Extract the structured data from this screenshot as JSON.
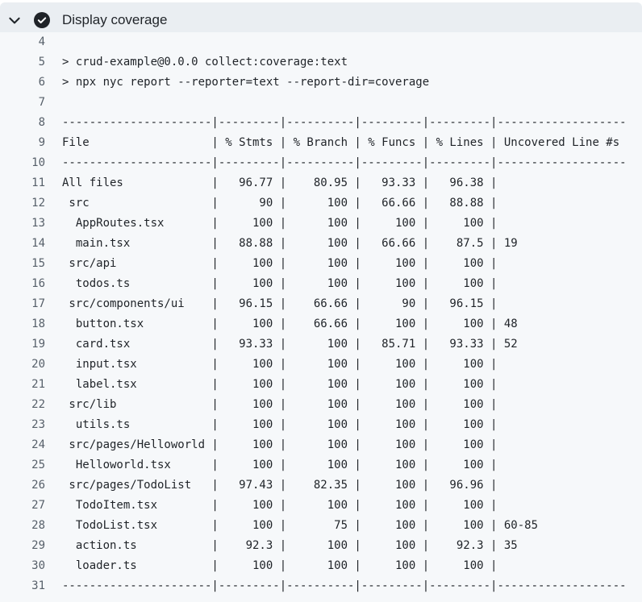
{
  "step": {
    "title": "Display coverage",
    "status": "success"
  },
  "log": [
    {
      "n": "4",
      "t": ""
    },
    {
      "n": "5",
      "t": "> crud-example@0.0.0 collect:coverage:text"
    },
    {
      "n": "6",
      "t": "> npx nyc report --reporter=text --report-dir=coverage"
    },
    {
      "n": "7",
      "t": ""
    },
    {
      "n": "8",
      "t": "----------------------|---------|----------|---------|---------|-------------------"
    },
    {
      "n": "9",
      "t": "File                  | % Stmts | % Branch | % Funcs | % Lines | Uncovered Line #s"
    },
    {
      "n": "10",
      "t": "----------------------|---------|----------|---------|---------|-------------------"
    },
    {
      "n": "11",
      "t": "All files             |   96.77 |    80.95 |   93.33 |   96.38 |"
    },
    {
      "n": "12",
      "t": " src                  |      90 |      100 |   66.66 |   88.88 |"
    },
    {
      "n": "13",
      "t": "  AppRoutes.tsx       |     100 |      100 |     100 |     100 |"
    },
    {
      "n": "14",
      "t": "  main.tsx            |   88.88 |      100 |   66.66 |    87.5 | 19"
    },
    {
      "n": "15",
      "t": " src/api              |     100 |      100 |     100 |     100 |"
    },
    {
      "n": "16",
      "t": "  todos.ts            |     100 |      100 |     100 |     100 |"
    },
    {
      "n": "17",
      "t": " src/components/ui    |   96.15 |    66.66 |      90 |   96.15 |"
    },
    {
      "n": "18",
      "t": "  button.tsx          |     100 |    66.66 |     100 |     100 | 48"
    },
    {
      "n": "19",
      "t": "  card.tsx            |   93.33 |      100 |   85.71 |   93.33 | 52"
    },
    {
      "n": "20",
      "t": "  input.tsx           |     100 |      100 |     100 |     100 |"
    },
    {
      "n": "21",
      "t": "  label.tsx           |     100 |      100 |     100 |     100 |"
    },
    {
      "n": "22",
      "t": " src/lib              |     100 |      100 |     100 |     100 |"
    },
    {
      "n": "23",
      "t": "  utils.ts            |     100 |      100 |     100 |     100 |"
    },
    {
      "n": "24",
      "t": " src/pages/Helloworld |     100 |      100 |     100 |     100 |"
    },
    {
      "n": "25",
      "t": "  Helloworld.tsx      |     100 |      100 |     100 |     100 |"
    },
    {
      "n": "26",
      "t": " src/pages/TodoList   |   97.43 |    82.35 |     100 |   96.96 |"
    },
    {
      "n": "27",
      "t": "  TodoItem.tsx        |     100 |      100 |     100 |     100 |"
    },
    {
      "n": "28",
      "t": "  TodoList.tsx        |     100 |       75 |     100 |     100 | 60-85"
    },
    {
      "n": "29",
      "t": "  action.ts           |    92.3 |      100 |     100 |    92.3 | 35"
    },
    {
      "n": "30",
      "t": "  loader.ts           |     100 |      100 |     100 |     100 |"
    },
    {
      "n": "31",
      "t": "----------------------|---------|----------|---------|---------|-------------------"
    }
  ]
}
